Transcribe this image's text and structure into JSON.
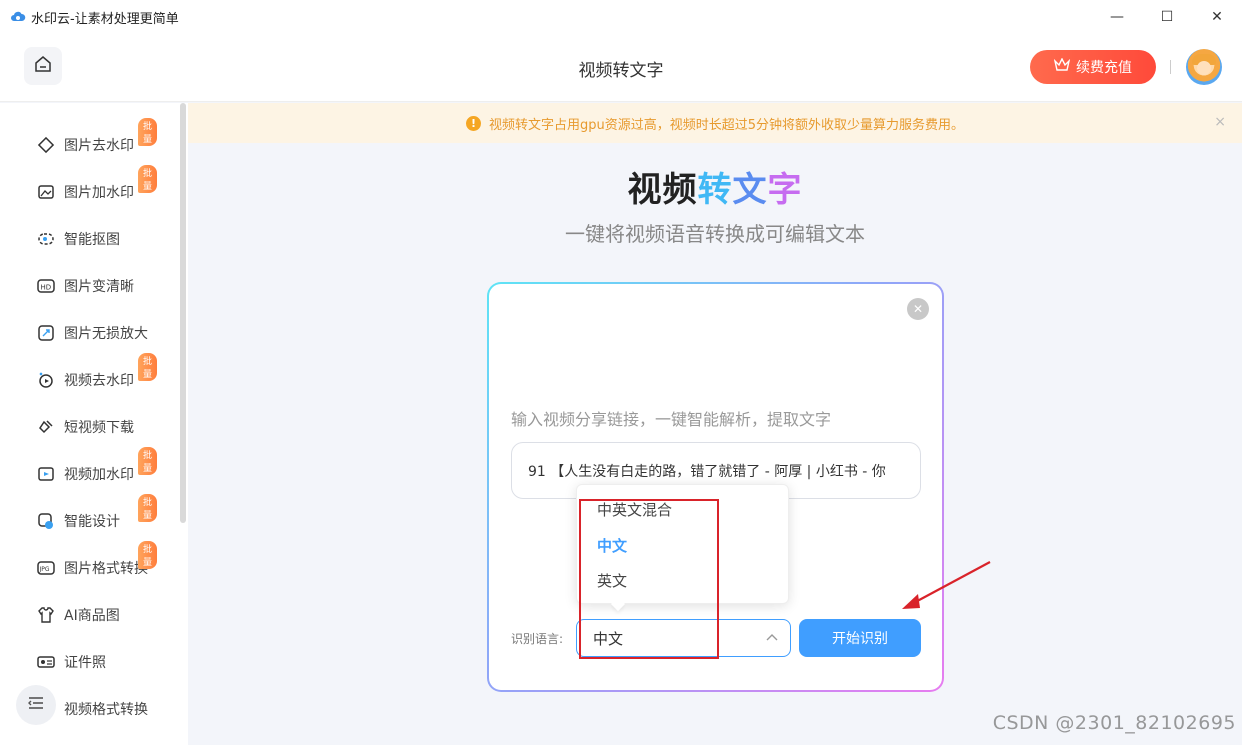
{
  "window": {
    "title": "水印云-让素材处理更简单",
    "minimize": "—",
    "maximize": "☐",
    "close": "✕"
  },
  "header": {
    "title": "视频转文字",
    "recharge_label": "续费充值"
  },
  "sidebar": {
    "items": [
      {
        "label": "图片去水印",
        "badge": "批量"
      },
      {
        "label": "图片加水印",
        "badge": "批量"
      },
      {
        "label": "智能抠图",
        "badge": ""
      },
      {
        "label": "图片变清晰",
        "badge": ""
      },
      {
        "label": "图片无损放大",
        "badge": ""
      },
      {
        "label": "视频去水印",
        "badge": "批量"
      },
      {
        "label": "短视频下载",
        "badge": ""
      },
      {
        "label": "视频加水印",
        "badge": "批量"
      },
      {
        "label": "智能设计",
        "badge": "批量"
      },
      {
        "label": "图片格式转换",
        "badge": "批量"
      },
      {
        "label": "AI商品图",
        "badge": ""
      },
      {
        "label": "证件照",
        "badge": ""
      },
      {
        "label": "视频格式转换",
        "badge": ""
      }
    ]
  },
  "notice": {
    "text": "视频转文字占用gpu资源过高，视频时长超过5分钟将额外收取少量算力服务费用。",
    "close": "×"
  },
  "hero": {
    "title_part1": "视频",
    "title_part2": "转",
    "title_part3": "文",
    "title_part4": "字",
    "subtitle": "一键将视频语音转换成可编辑文本"
  },
  "card": {
    "close": "✕",
    "hint": "输入视频分享链接，一键智能解析，提取文字",
    "link_value": "91 【人生没有白走的路，错了就错了 - 阿厚 | 小红书 - 你",
    "lang_label": "识别语言:",
    "lang_selected": "中文",
    "start_label": "开始识别"
  },
  "dropdown": {
    "options": [
      "中英文混合",
      "中文",
      "英文"
    ],
    "selected": "中文"
  },
  "colors": {
    "accent": "#409eff",
    "recharge": "#ff5a40",
    "notice_text": "#e79a2e",
    "annotation": "#d9232a"
  },
  "watermark": "CSDN @2301_82102695"
}
